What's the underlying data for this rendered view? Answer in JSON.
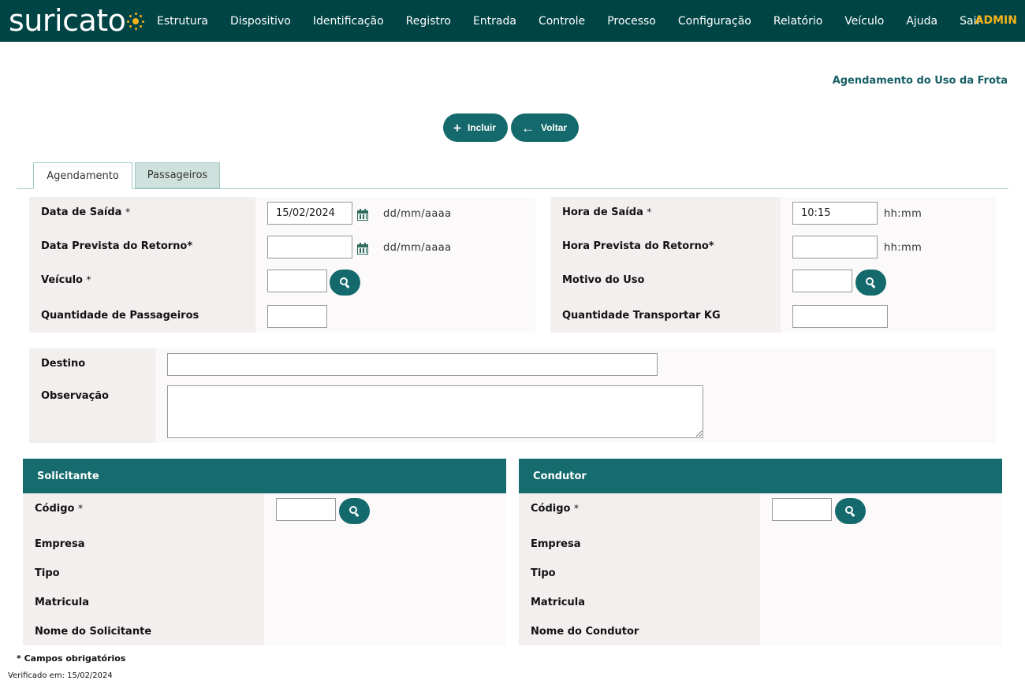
{
  "header": {
    "logo_text": "suricato",
    "nav": [
      "Estrutura",
      "Dispositivo",
      "Identificação",
      "Registro",
      "Entrada",
      "Controle",
      "Processo",
      "Configuração",
      "Relatório",
      "Veículo",
      "Ajuda",
      "Sair"
    ],
    "user": "ADMIN"
  },
  "page": {
    "title": "Agendamento do Uso da Frota"
  },
  "actions": {
    "include_label": "Incluir",
    "include_icon": "plus-icon",
    "back_label": "Voltar",
    "back_icon": "arrow-left-icon"
  },
  "tabs": {
    "schedule": "Agendamento",
    "passengers": "Passageiros",
    "active": "Agendamento"
  },
  "form": {
    "departure_date": {
      "label": "Data de Saída",
      "req": "*",
      "value": "15/02/2024",
      "hint": "dd/mm/aaaa"
    },
    "return_date": {
      "label": "Data Prevista do Retorno*",
      "value": "",
      "hint": "dd/mm/aaaa"
    },
    "vehicle": {
      "label": "Veículo",
      "req": "*",
      "value": ""
    },
    "passenger_qty": {
      "label": "Quantidade de Passageiros",
      "value": ""
    },
    "departure_time": {
      "label": "Hora de Saída",
      "req": "*",
      "value": "10:15",
      "hint": "hh:mm"
    },
    "return_time": {
      "label": "Hora Prevista do Retorno*",
      "value": "",
      "hint": "hh:mm"
    },
    "reason": {
      "label": "Motivo do Uso",
      "value": ""
    },
    "cargo_kg": {
      "label": "Quantidade Transportar KG",
      "value": ""
    },
    "destination": {
      "label": "Destino",
      "value": ""
    },
    "notes": {
      "label": "Observação",
      "value": ""
    }
  },
  "requester": {
    "title": "Solicitante",
    "code_label": "Código",
    "req": "*",
    "code_value": "",
    "company_label": "Empresa",
    "type_label": "Tipo",
    "registration_label": "Matricula",
    "name_label": "Nome do Solicitante"
  },
  "driver": {
    "title": "Condutor",
    "code_label": "Código",
    "req": "*",
    "code_value": "",
    "company_label": "Empresa",
    "type_label": "Tipo",
    "registration_label": "Matricula",
    "name_label": "Nome do Condutor"
  },
  "footer": {
    "required_note": "* Campos obrigatórios",
    "verified": "Verificado em: 15/02/2024"
  },
  "colors": {
    "nav_bg": "#004445",
    "accent": "#14696c",
    "admin": "#f5b21a"
  }
}
